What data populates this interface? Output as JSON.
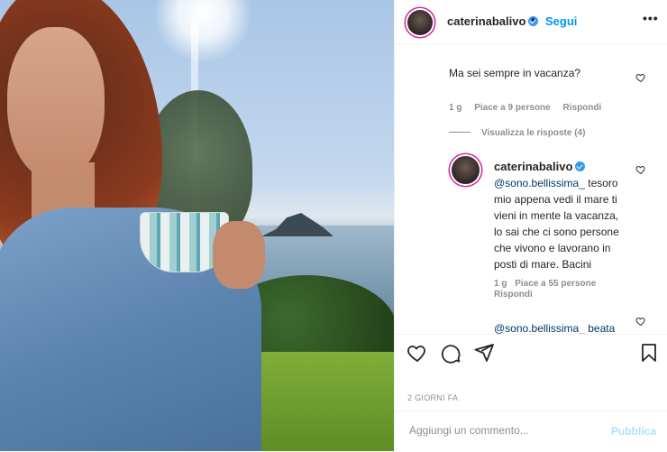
{
  "post": {
    "username": "caterinabalivo",
    "separator": "•",
    "follow_label": "Segui",
    "more_label": "•••"
  },
  "comments": [
    {
      "text": "Ma sei sempre in vacanza?",
      "time": "1 g",
      "likes": "Piace a 9 persone",
      "reply": "Rispondi"
    },
    {
      "view_replies": "Visualizza le risposte (4)"
    },
    {
      "username": "caterinabalivo",
      "mention": "@sono.bellissima_",
      "text": " tesoro mio appena vedi il mare ti vieni in mente la vacanza, lo sai che ci sono persone che vivono e lavorano in posti di mare. Bacini",
      "time": "1 g",
      "likes": "Piace a 55 persone",
      "reply": "Rispondi"
    },
    {
      "text": "@sono.bellissima_ beata"
    }
  ],
  "timestamp": "2 GIORNI FA",
  "add_comment": {
    "placeholder": "Aggiungi un commento...",
    "post_label": "Pubblica"
  },
  "icons": [
    "heart-icon",
    "comment-icon",
    "share-icon",
    "bookmark-icon",
    "verified-icon"
  ],
  "colors": {
    "link_blue": "#0095f6",
    "verified": "#3897f0",
    "muted": "#8e8e8e",
    "post_disabled": "#b2dffc"
  }
}
